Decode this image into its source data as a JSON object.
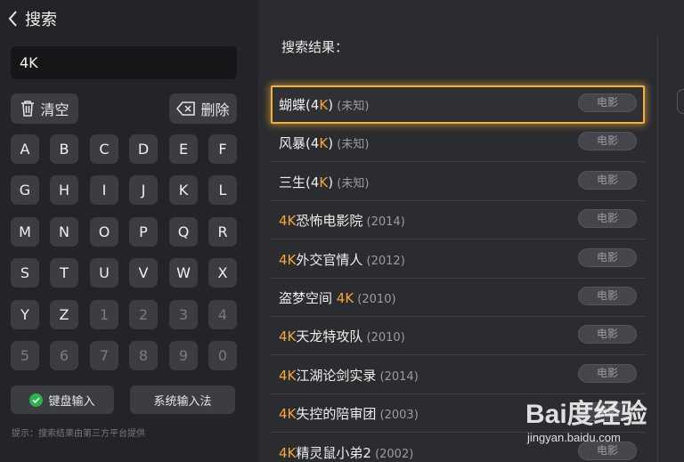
{
  "header": {
    "title": "搜索",
    "back_icon": "chevron-left-icon"
  },
  "search": {
    "value": "4K"
  },
  "actions": {
    "clear_label": "清空",
    "clear_icon": "trash-icon",
    "delete_label": "删除",
    "delete_icon": "backspace-icon"
  },
  "keyboard": {
    "rows": [
      [
        "A",
        "B",
        "C",
        "D",
        "E",
        "F"
      ],
      [
        "G",
        "H",
        "I",
        "J",
        "K",
        "L"
      ],
      [
        "M",
        "N",
        "O",
        "P",
        "Q",
        "R"
      ],
      [
        "S",
        "T",
        "U",
        "V",
        "W",
        "X"
      ],
      [
        "Y",
        "Z",
        "1",
        "2",
        "3",
        "4"
      ],
      [
        "5",
        "6",
        "7",
        "8",
        "9",
        "0"
      ]
    ]
  },
  "input_modes": {
    "keyboard_label": "键盘输入",
    "keyboard_icon": "check-circle-icon",
    "system_label": "系统输入法"
  },
  "hint": "提示：搜索结果由第三方平台提供",
  "results": {
    "header": "搜索结果：",
    "items": [
      {
        "pre": "蝴蝶(4",
        "hl": "K",
        "post": ")",
        "meta": " (未知)",
        "tag": "电影"
      },
      {
        "pre": "风暴(4",
        "hl": "K",
        "post": ")",
        "meta": " (未知)",
        "tag": "电影"
      },
      {
        "pre": "三生(4",
        "hl": "K",
        "post": ")",
        "meta": " (未知)",
        "tag": "电影"
      },
      {
        "pre": "",
        "hl": "4K",
        "post": "恐怖电影院",
        "meta": " (2014)",
        "tag": "电影"
      },
      {
        "pre": "",
        "hl": "4K",
        "post": "外交官情人",
        "meta": " (2012)",
        "tag": "电影"
      },
      {
        "pre": "盗梦空间 ",
        "hl": "4K",
        "post": "",
        "meta": " (2010)",
        "tag": "电影"
      },
      {
        "pre": "",
        "hl": "4K",
        "post": "天龙特攻队",
        "meta": " (2010)",
        "tag": "电影"
      },
      {
        "pre": "",
        "hl": "4K",
        "post": "江湖论剑实录",
        "meta": " (2014)",
        "tag": "电影"
      },
      {
        "pre": "",
        "hl": "4K",
        "post": "失控的陪审团",
        "meta": " (2003)",
        "tag": "电影"
      },
      {
        "pre": "",
        "hl": "4K",
        "post": "精灵鼠小弟2",
        "meta": " (2002)",
        "tag": "电影"
      }
    ]
  },
  "watermark": {
    "brand": "Bai度经验",
    "url": "jingyan.baidu.com"
  },
  "colors": {
    "highlight": "#f4a73a",
    "focus_border": "#f3b03b",
    "check_green": "#29b34a"
  }
}
